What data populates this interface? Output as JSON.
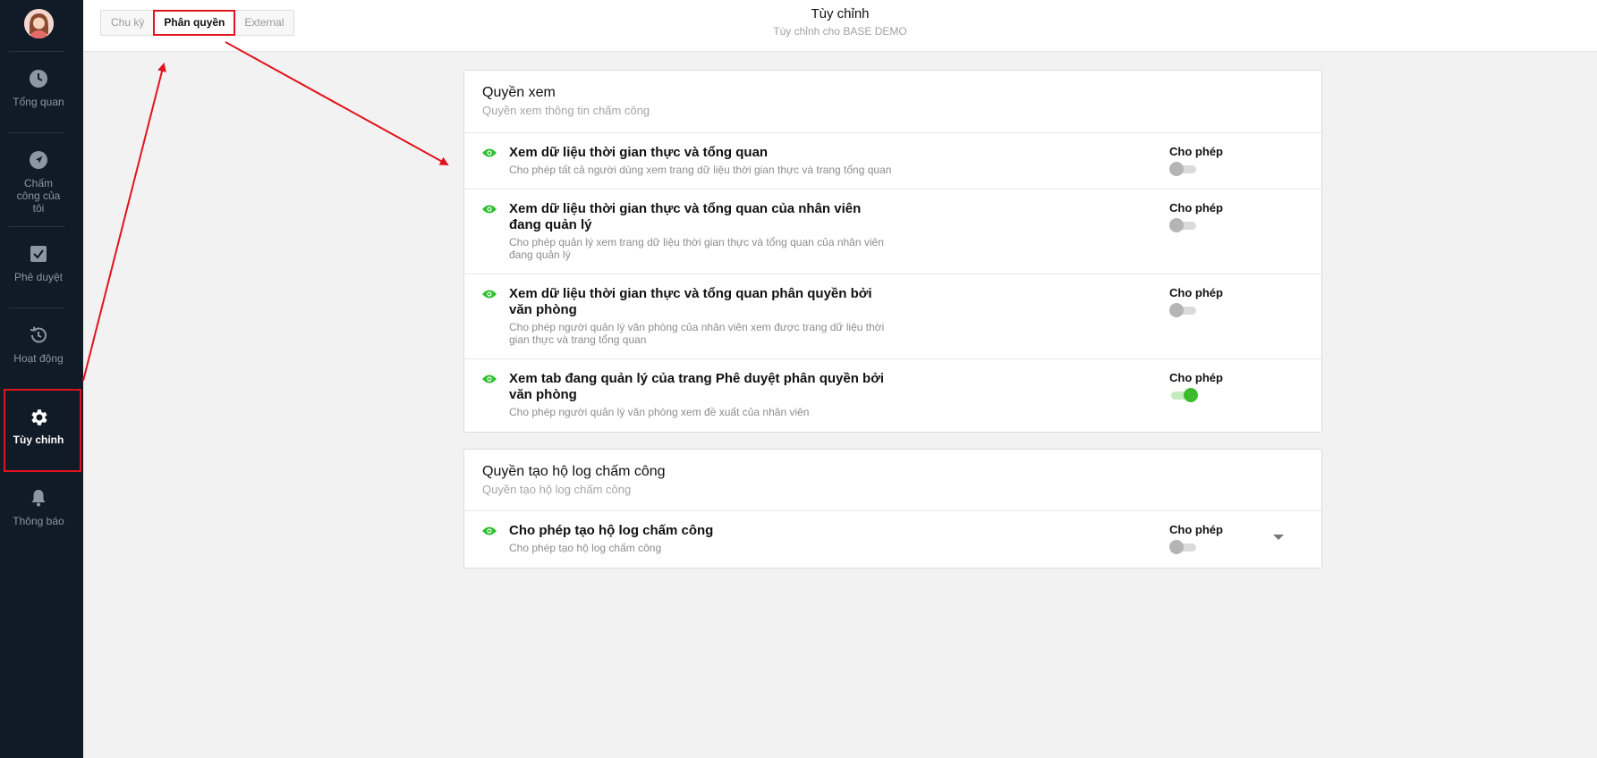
{
  "sidebar": {
    "items": [
      {
        "label": "Tổng quan",
        "icon": "clock-icon"
      },
      {
        "label": "Chấm công của tôi",
        "icon": "navigation-arrow-icon"
      },
      {
        "label": "Phê duyệt",
        "icon": "checkbox-icon"
      },
      {
        "label": "Hoạt động",
        "icon": "history-icon"
      },
      {
        "label": "Tùy chỉnh",
        "icon": "gear-icon",
        "active": true
      },
      {
        "label": "Thông báo",
        "icon": "bell-icon"
      }
    ]
  },
  "tabs": [
    "Chu kỳ",
    "Phân quyền",
    "External"
  ],
  "active_tab": "Phân quyền",
  "header": {
    "title": "Tùy chỉnh",
    "subtitle": "Tùy chỉnh cho BASE DEMO"
  },
  "sections": [
    {
      "title": "Quyền xem",
      "subtitle": "Quyền xem thông tin chấm công",
      "rows": [
        {
          "title": "Xem dữ liệu thời gian thực và tổng quan",
          "desc": "Cho phép tất cả người dùng xem trang dữ liệu thời gian thực và trang tổng quan",
          "perm": "Cho phép",
          "on": false
        },
        {
          "title": "Xem dữ liệu thời gian thực và tổng quan của nhân viên đang quản lý",
          "desc": "Cho phép quản lý xem trang dữ liệu thời gian thực và tổng quan của nhân viên đang quản lý",
          "perm": "Cho phép",
          "on": false
        },
        {
          "title": "Xem dữ liệu thời gian thực và tổng quan phân quyền bởi văn phòng",
          "desc": "Cho phép người quản lý văn phòng của nhân viên xem được trang dữ liệu thời gian thực và trang tổng quan",
          "perm": "Cho phép",
          "on": false
        },
        {
          "title": "Xem tab đang quản lý của trang Phê duyệt phân quyền bởi văn phòng",
          "desc": "Cho phép người quản lý văn phòng xem đề xuất của nhân viên",
          "perm": "Cho phép",
          "on": true
        }
      ]
    },
    {
      "title": "Quyền tạo hộ log chấm công",
      "subtitle": "Quyền tạo hộ log chấm công",
      "rows": [
        {
          "title": "Cho phép tạo hộ log chấm công",
          "desc": "Cho phép tạo hộ log chấm công",
          "perm": "Cho phép",
          "on": false
        }
      ]
    }
  ],
  "colors": {
    "sidebar_bg": "#111a27",
    "accent_green": "#3dbb2c",
    "annotation_red": "#e1131c"
  }
}
